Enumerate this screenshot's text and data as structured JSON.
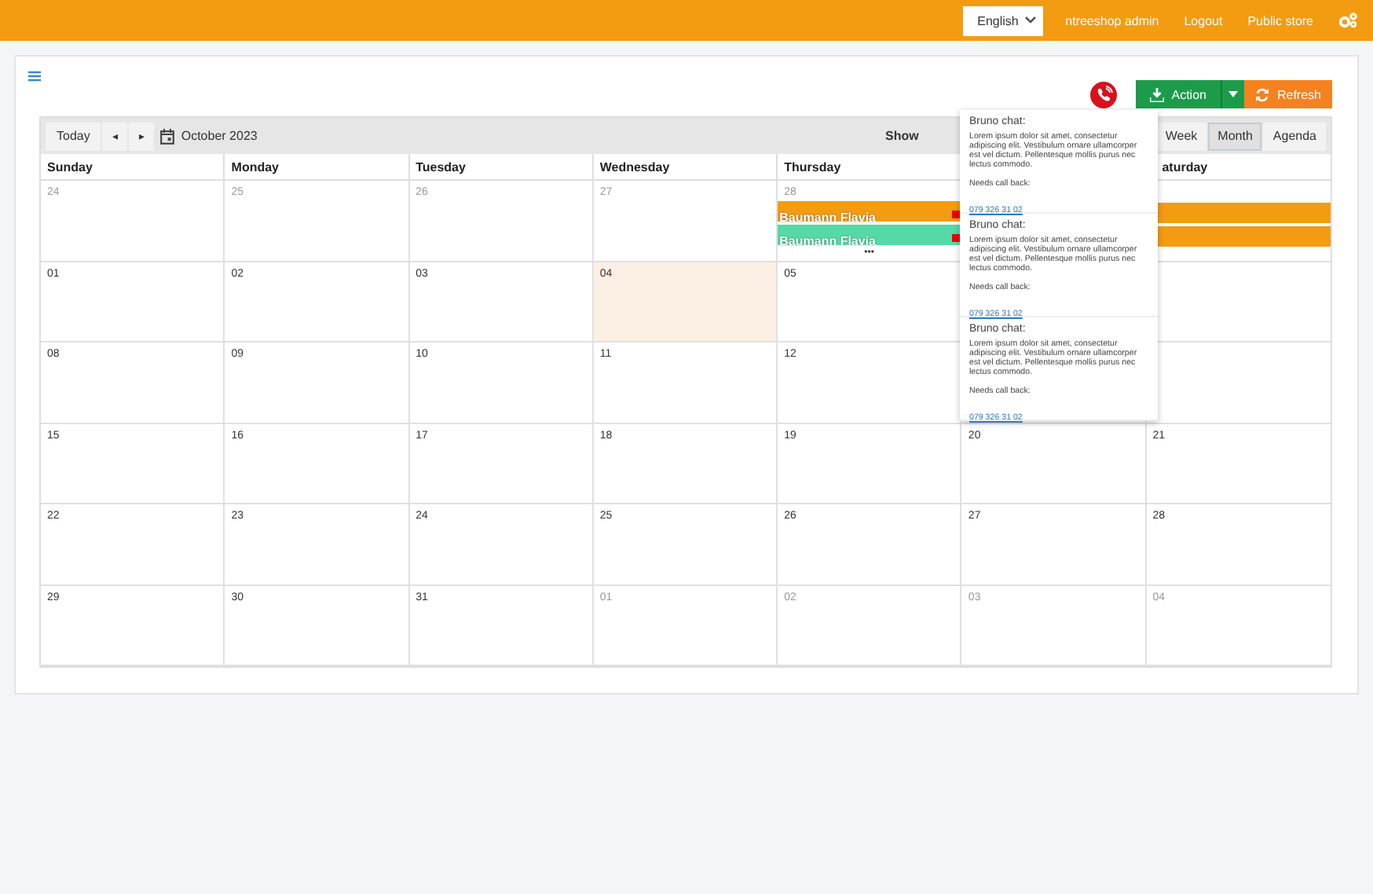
{
  "topbar": {
    "language": "English",
    "links": [
      "ntreeshop admin",
      "Logout",
      "Public store"
    ]
  },
  "toolbar": {
    "action": "Action",
    "refresh": "Refresh"
  },
  "calendar": {
    "today_button": "Today",
    "prev": "◂",
    "next": "▸",
    "month": "October 2023",
    "show_label": "Show",
    "views": [
      {
        "label": "Week",
        "selected": false
      },
      {
        "label": "Month",
        "selected": true
      },
      {
        "label": "Agenda",
        "selected": false
      }
    ],
    "weekdays": [
      "Sunday",
      "Monday",
      "Tuesday",
      "Wednesday",
      "Thursday",
      "aturday"
    ],
    "weeks": [
      {
        "days": [
          {
            "label": "24",
            "other_month": true,
            "today": false
          },
          {
            "label": "25",
            "other_month": true,
            "today": false
          },
          {
            "label": "26",
            "other_month": true,
            "today": false
          },
          {
            "label": "27",
            "other_month": true,
            "today": false
          },
          {
            "label": "28",
            "other_month": true,
            "today": false,
            "events": [
              {
                "title": "Baumann Flavia",
                "color": "#f39c12"
              },
              {
                "title": "Baumann Flavia",
                "color": "#56d9a6"
              }
            ],
            "more": "•••"
          },
          {
            "events": [
              {
                "color": "#f39c12"
              },
              {
                "color": "#f39c12"
              }
            ]
          }
        ]
      },
      {
        "days": [
          {
            "label": "01",
            "other_month": false,
            "today": false
          },
          {
            "label": "02",
            "other_month": false,
            "today": false
          },
          {
            "label": "03",
            "other_month": false,
            "today": false
          },
          {
            "label": "04",
            "other_month": false,
            "today": true
          },
          {
            "label": "05",
            "other_month": false,
            "today": false
          }
        ]
      },
      {
        "days": [
          {
            "label": "08",
            "other_month": false,
            "today": false
          },
          {
            "label": "09",
            "other_month": false,
            "today": false
          },
          {
            "label": "10",
            "other_month": false,
            "today": false
          },
          {
            "label": "11",
            "other_month": false,
            "today": false
          },
          {
            "label": "12",
            "other_month": false,
            "today": false
          }
        ]
      },
      {
        "days": [
          {
            "label": "15",
            "other_month": false,
            "today": false
          },
          {
            "label": "16",
            "other_month": false,
            "today": false
          },
          {
            "label": "17",
            "other_month": false,
            "today": false
          },
          {
            "label": "18",
            "other_month": false,
            "today": false
          },
          {
            "label": "19",
            "other_month": false,
            "today": false
          },
          {
            "label": "20",
            "other_month": false,
            "today": false
          },
          {
            "label": "21",
            "other_month": false,
            "today": false
          }
        ]
      },
      {
        "days": [
          {
            "label": "22",
            "other_month": false,
            "today": false
          },
          {
            "label": "23",
            "other_month": false,
            "today": false
          },
          {
            "label": "24",
            "other_month": false,
            "today": false
          },
          {
            "label": "25",
            "other_month": false,
            "today": false
          },
          {
            "label": "26",
            "other_month": false,
            "today": false
          },
          {
            "label": "27",
            "other_month": false,
            "today": false
          },
          {
            "label": "28",
            "other_month": false,
            "today": false
          }
        ]
      },
      {
        "days": [
          {
            "label": "29",
            "other_month": false,
            "today": false
          },
          {
            "label": "30",
            "other_month": false,
            "today": false
          },
          {
            "label": "31",
            "other_month": false,
            "today": false
          },
          {
            "label": "01",
            "other_month": true,
            "today": false
          },
          {
            "label": "02",
            "other_month": true,
            "today": false
          },
          {
            "label": "03",
            "other_month": true,
            "today": false
          },
          {
            "label": "04",
            "other_month": true,
            "today": false
          }
        ]
      }
    ]
  },
  "popover": {
    "items": [
      {
        "title": "Bruno chat:",
        "body": "Lorem ipsum dolor sit amet, consectetur adipiscing elit. Vestibulum ornare ullamcorper est vel dictum. Pellentesque mollis purus nec lectus commodo.",
        "callback_label": "Needs call back:",
        "phone": "079 326 31 02"
      },
      {
        "title": "Bruno chat:",
        "body": "Lorem ipsum dolor sit amet, consectetur adipiscing elit. Vestibulum ornare ullamcorper est vel dictum. Pellentesque mollis purus nec lectus commodo.",
        "callback_label": "Needs call back:",
        "phone": "079 326 31 02"
      },
      {
        "title": "Bruno chat:",
        "body": "Lorem ipsum dolor sit amet, consectetur adipiscing elit. Vestibulum ornare ullamcorper est vel dictum. Pellentesque mollis purus nec lectus commodo.",
        "callback_label": "Needs call back:",
        "phone": "079 326 31 02"
      }
    ]
  }
}
